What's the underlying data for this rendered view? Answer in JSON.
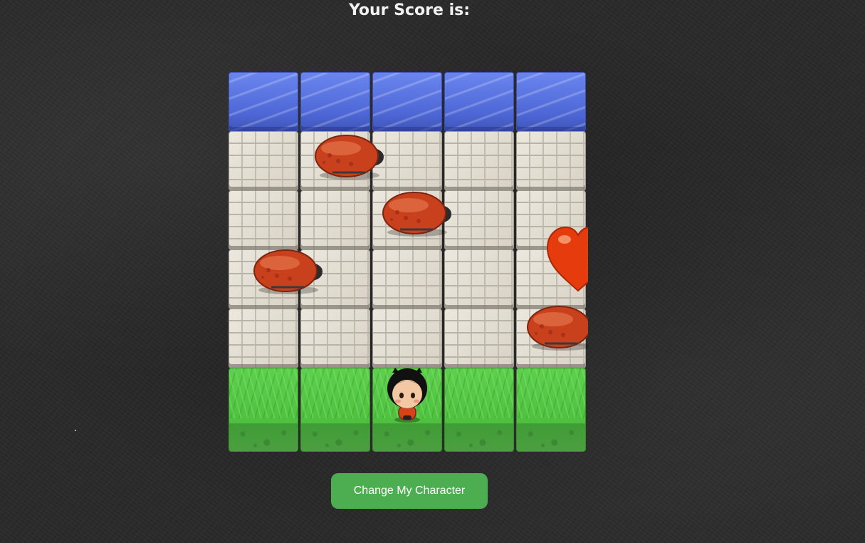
{
  "score": {
    "title": "Your Score is:"
  },
  "board": {
    "rows": [
      [
        "water",
        "water",
        "water",
        "water",
        "water"
      ],
      [
        "stone",
        "stone",
        "stone",
        "stone",
        "stone"
      ],
      [
        "stone",
        "stone",
        "stone",
        "stone",
        "stone"
      ],
      [
        "stone",
        "stone",
        "stone",
        "stone",
        "stone"
      ],
      [
        "stone",
        "stone",
        "stone",
        "stone",
        "stone"
      ],
      [
        "grass",
        "grass",
        "grass",
        "grass",
        "grass"
      ]
    ],
    "enemies": [
      {
        "name": "ladybug-enemy",
        "row": 2,
        "col": 2
      },
      {
        "name": "ladybug-enemy",
        "row": 3,
        "col": 3
      },
      {
        "name": "ladybug-enemy",
        "row": 4,
        "col": 1
      },
      {
        "name": "ladybug-enemy",
        "row": 5,
        "col": 5
      }
    ],
    "heart": {
      "name": "heart-icon",
      "row": 4,
      "col": 5
    },
    "player": {
      "name": "player-character",
      "row": 6,
      "col": 3
    }
  },
  "controls": {
    "change_character_label": "Change My Character"
  },
  "colors": {
    "button": "#4cae50",
    "bug_shell": "#c8401c",
    "heart": "#e53b0d"
  }
}
